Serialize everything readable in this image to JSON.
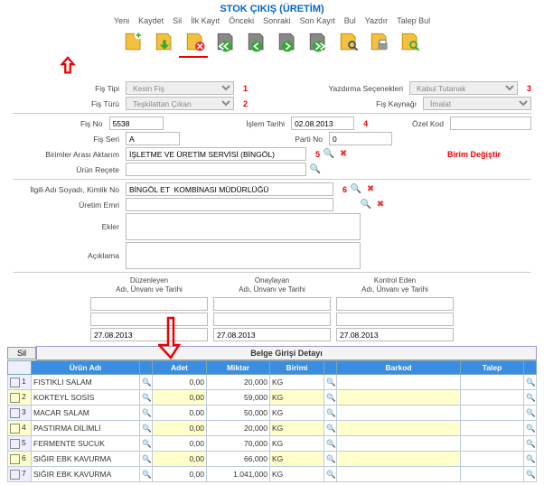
{
  "title": "STOK ÇIKIŞ (ÜRETİM)",
  "menu": [
    "Yeni",
    "Kaydet",
    "Sil",
    "İlk Kayıt",
    "Önceki",
    "Sonraki",
    "Son Kayıt",
    "Bul",
    "Yazdır",
    "Talep Bul"
  ],
  "form": {
    "fisTipiLbl": "Fiş Tipi",
    "fisTipi": "Kesin Fiş",
    "yazdirLbl": "Yazdırma Seçenekleri",
    "yazdir": "Kabul Tutanak",
    "fisTuruLbl": "Fiş Türü",
    "fisTuru": "Teşkilattan Çıkan",
    "fisKaynagiLbl": "Fiş Kaynağı",
    "fisKaynagi": "İmalat",
    "fisNoLbl": "Fiş No",
    "fisNo": "5538",
    "islemTarihiLbl": "İşlem Tarihi",
    "islemTarihi": "02.08.2013",
    "ozelKodLbl": "Özel Kod",
    "ozelKod": "",
    "fisSeriLbl": "Fiş Seri",
    "fisSeri": "A",
    "partiNoLbl": "Parti No",
    "partiNo": "0",
    "birimAktarimLbl": "Birimler Arası Aktarım",
    "birimAktarim": "İŞLETME VE ÜRETİM SERVİSİ (BİNGÖL)",
    "birimDegistir": "Birim Değiştir",
    "urunReceteLbl": "Ürün Reçete",
    "urunRecete": "",
    "ilgiliLbl": "İlgili Adı Soyadı, Kimlik No",
    "ilgili": "BİNGÖL ET  KOMBİNASI MÜDÜRLÜĞÜ",
    "uretimEmriLbl": "Üretim Emri",
    "uretimEmri": "",
    "eklerLbl": "Ekler",
    "ekler": "",
    "aciklamaLbl": "Açıklama",
    "aciklama": ""
  },
  "markers": {
    "m1": "1",
    "m2": "2",
    "m3": "3",
    "m4": "4",
    "m5": "5",
    "m6": "6"
  },
  "sig": {
    "h1a": "Düzenleyen",
    "h1b": "Adı, Ünvanı ve Tarihi",
    "h2a": "Onaylayan",
    "h2b": "Adı, Ünvanı ve Tarihi",
    "h3a": "Kontrol Eden",
    "h3b": "Adı, Ünvanı ve Tarihi",
    "d1": "27.08.2013",
    "d2": "27.08.2013",
    "d3": "27.08.2013"
  },
  "grid": {
    "deleteBtn": "Sil",
    "title": "Belge Girişi Detayı",
    "cols": {
      "urun": "Ürün Adı",
      "adet": "Adet",
      "miktar": "Miktar",
      "birimi": "Birimi",
      "barkod": "Barkod",
      "talep": "Talep"
    },
    "rows": [
      {
        "n": "1",
        "urun": "FISTIKLI SALAM",
        "adet": "0,00",
        "miktar": "20,000",
        "birimi": "KG"
      },
      {
        "n": "2",
        "urun": "KOKTEYL SOSİS",
        "adet": "0,00",
        "miktar": "59,000",
        "birimi": "KG"
      },
      {
        "n": "3",
        "urun": "MACAR SALAM",
        "adet": "0,00",
        "miktar": "50,000",
        "birimi": "KG"
      },
      {
        "n": "4",
        "urun": "PASTIRMA DİLİMLİ",
        "adet": "0,00",
        "miktar": "20,000",
        "birimi": "KG"
      },
      {
        "n": "5",
        "urun": "FERMENTE SUCUK",
        "adet": "0,00",
        "miktar": "70,000",
        "birimi": "KG"
      },
      {
        "n": "6",
        "urun": "SIĞIR EBK KAVURMA",
        "adet": "0,00",
        "miktar": "66,000",
        "birimi": "KG"
      },
      {
        "n": "7",
        "urun": "SIĞIR EBK KAVURMA",
        "adet": "0,00",
        "miktar": "1.041,000",
        "birimi": "KG"
      }
    ]
  }
}
